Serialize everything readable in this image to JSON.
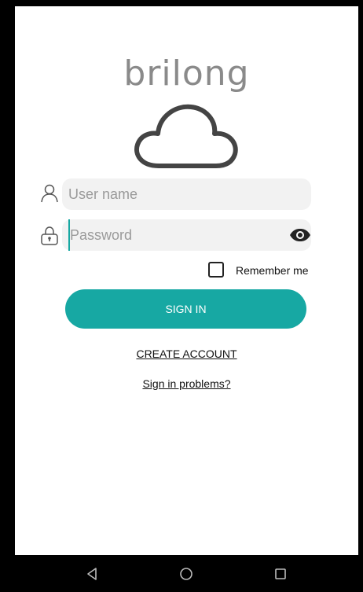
{
  "logo": {
    "text": "brilong"
  },
  "form": {
    "username": {
      "placeholder": "User name",
      "value": ""
    },
    "password": {
      "placeholder": "Password",
      "value": ""
    },
    "remember_label": "Remember me",
    "remember_checked": false,
    "signin_label": "SIGN IN"
  },
  "links": {
    "create_account": "CREATE ACCOUNT",
    "sign_in_problems": "Sign in problems?"
  },
  "icons": {
    "user": "person-icon",
    "lock": "lock-icon",
    "eye": "eye-icon",
    "nav_back": "back-triangle-icon",
    "nav_home": "home-circle-icon",
    "nav_recents": "recents-square-icon"
  },
  "colors": {
    "accent": "#17a8a3",
    "logo_gray": "#8a8a8a",
    "logo_dot": "#e53935"
  }
}
